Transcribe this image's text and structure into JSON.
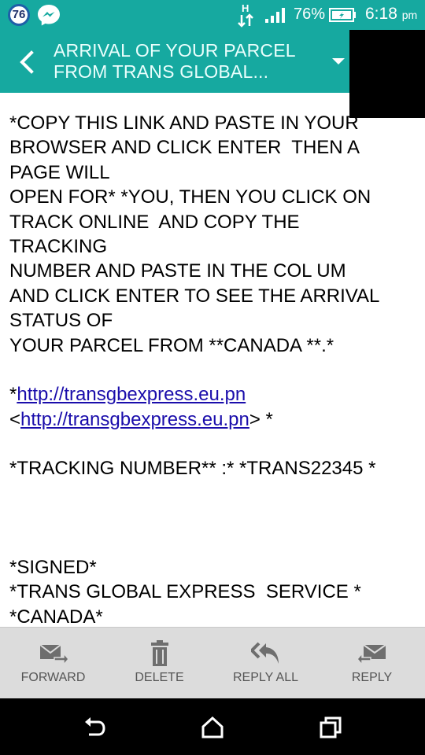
{
  "status_bar": {
    "badge_count": "76",
    "network_type": "H",
    "battery_percent": "76%",
    "time": "6:18",
    "time_suffix": "pm"
  },
  "header": {
    "title_line1": "ARRIVAL OF YOUR PARCEL",
    "title_line2": "FROM TRANS GLOBAL..."
  },
  "message": {
    "l1": "*COPY THIS LINK AND PASTE IN YOUR",
    "l2": "BROWSER AND CLICK ENTER  THEN A",
    "l3": "PAGE WILL",
    "l4": "OPEN FOR* *YOU, THEN YOU CLICK ON",
    "l5": "TRACK ONLINE  AND COPY THE",
    "l6": "TRACKING",
    "l7": "NUMBER AND PASTE IN THE COL UM",
    "l8": "AND CLICK ENTER TO SEE THE ARRIVAL",
    "l9": "STATUS OF",
    "l10": "YOUR PARCEL FROM **CANADA **.*",
    "link1_prefix": "*",
    "link1": "http://transgbexpress.eu.pn",
    "link2_prefix": "<",
    "link2": "http://transgbexpress.eu.pn",
    "link2_suffix": "> *",
    "tracking": "*TRACKING NUMBER** :* *TRANS22345 *",
    "signed": "*SIGNED*",
    "company": "*TRANS GLOBAL EXPRESS  SERVICE *",
    "country": "*CANADA*"
  },
  "toolbar": {
    "forward": "FORWARD",
    "delete": "DELETE",
    "reply_all": "REPLY ALL",
    "reply": "REPLY"
  },
  "colors": {
    "accent": "#16a9a0",
    "link": "#1a0dab",
    "toolbar_bg": "#dcdcdc",
    "toolbar_icon": "#6e6e6e"
  },
  "icons": {
    "status": [
      "notification-badge",
      "messenger-icon",
      "network-hplus-icon",
      "signal-icon",
      "battery-charging-icon"
    ],
    "header": [
      "back-arrow-icon",
      "dropdown-caret-icon"
    ],
    "toolbar": [
      "forward-mail-icon",
      "trash-icon",
      "reply-all-icon",
      "reply-mail-icon"
    ],
    "nav": [
      "back-icon",
      "home-icon",
      "recents-icon"
    ]
  }
}
